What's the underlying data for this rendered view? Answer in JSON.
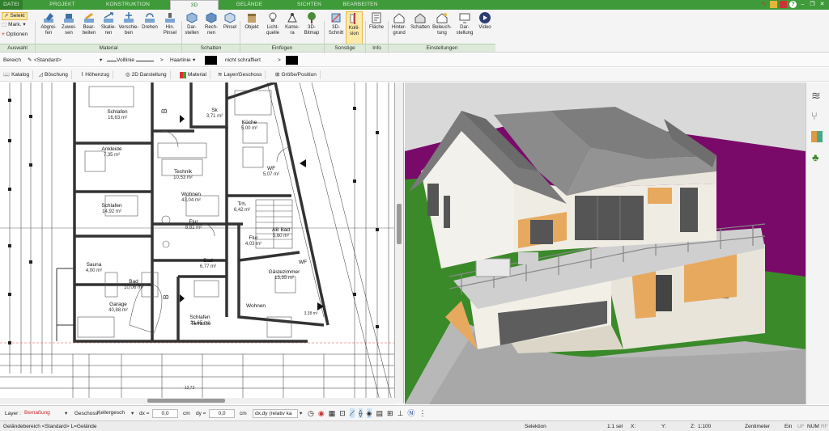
{
  "tabs": [
    {
      "label": "DATEI"
    },
    {
      "label": "PROJEKT"
    },
    {
      "label": "KONSTRUKTION"
    },
    {
      "label": "3D"
    },
    {
      "label": "GELÄNDE"
    },
    {
      "label": "SICHTEN"
    },
    {
      "label": "BEARBEITEN"
    }
  ],
  "ribbon": {
    "auswahl": {
      "selekt": "Selekt",
      "mark": "Mark.",
      "optionen": "Optionen"
    },
    "material": [
      "Abgrei-\nfen",
      "Zuwei-\nsen",
      "Bear-\nbeiten",
      "Skalie-\nren",
      "Verschie-\nben",
      "Drehen",
      "Hin.\nPinsel"
    ],
    "schatten": [
      "Dar-\nstellen",
      "Rech-\nnen",
      "Pinsel"
    ],
    "einfuegen": [
      "Objekt",
      "Licht-\nquelle",
      "Kame-\nra",
      "3D-\nBitmap"
    ],
    "sonstige": [
      "3D-\nSchnitt",
      "Kolli-\nsion"
    ],
    "info": [
      "Fläche"
    ],
    "einstellungen": [
      "Hinter-\ngrund",
      "Schatten",
      "Beleuch-\ntung",
      "Dar-\nstellung",
      "Video"
    ],
    "groups": [
      "Auswahl",
      "Material",
      "Schatten",
      "Einfügen",
      "Sonstige",
      "Info",
      "Einstellungen"
    ]
  },
  "propbar": {
    "bereich": "Bereich",
    "standard": "<Standard>",
    "linie": "Volllinie",
    "gt1": ">",
    "haarlinie": "Haarlinie",
    "gt2": ">",
    "schraffur": "nicht schraffiert",
    "gt3": ">"
  },
  "toolbar2": [
    "Katalog",
    "Böschung",
    "Höhenzug",
    "2D Darstellung",
    "Material",
    "Layer/Geschoss",
    "Größe/Position"
  ],
  "plan": {
    "rooms": [
      {
        "name": "Schlafen",
        "area": "16,63 m²"
      },
      {
        "name": "Ankleide",
        "area": "7,35 m²"
      },
      {
        "name": "Schlafen",
        "area": "14,92 m²"
      },
      {
        "name": "Sk",
        "area": "3,71 m²"
      },
      {
        "name": "Küche",
        "area": "5,00 m²"
      },
      {
        "name": "Technik",
        "area": "10,53 m²"
      },
      {
        "name": "WF",
        "area": "5,07 m²"
      },
      {
        "name": "Wohnen",
        "area": "43,04 m²"
      },
      {
        "name": "Trh.",
        "area": "6,42 m²"
      },
      {
        "name": "Flur",
        "area": "8,81 m²"
      },
      {
        "name": "AB Bad",
        "area": "5,60 m²"
      },
      {
        "name": "Flur",
        "area": "4,03 m²"
      },
      {
        "name": "Sauna",
        "area": "4,00 m²"
      },
      {
        "name": "Bad",
        "area": "6,77 m²"
      },
      {
        "name": "WF",
        "area": ""
      },
      {
        "name": "Bad",
        "area": "10,06 m²"
      },
      {
        "name": "Gästezimmer",
        "area": "13,35 m²"
      },
      {
        "name": "Garage",
        "area": "40,88 m²"
      },
      {
        "name": "Schlafen",
        "area": "21,65 m²"
      },
      {
        "name": "Wohnen",
        "area": ""
      },
      {
        "name": "Terrasse",
        "area": ""
      }
    ],
    "section_marks": [
      "B",
      "B"
    ],
    "bottom_dim": "13,73",
    "right_dim": "3,38 m²"
  },
  "bottombar": {
    "layer_label": "Layer :",
    "layer_value": "Bemaßung",
    "geschoss_label": "Geschoss :",
    "geschoss_value": "Kellergesch",
    "dx_label": "dx =",
    "dx_value": "0,0",
    "dx_unit": "cm",
    "dy_label": "dy =",
    "dy_value": "0,0",
    "dy_unit": "cm",
    "mode": "dx,dy (relativ ka"
  },
  "statusbar": {
    "left": "Geländebereich <Standard> L=Gelände",
    "selektion": "Selektion",
    "sel": "1:1 sel",
    "x": "X:",
    "y": "Y:",
    "z": "Z:",
    "scale": "1:100",
    "unit": "Zentimeter",
    "ein": "Ein",
    "uf": "UF",
    "num": "NUM",
    "rf": "RF"
  },
  "colors": {
    "accent": "#3f9a3a",
    "highlight": "#fde9a8",
    "grass": "#3a8a2a",
    "terrain": "#7a0a6a",
    "roof": "#6e6e6e"
  }
}
